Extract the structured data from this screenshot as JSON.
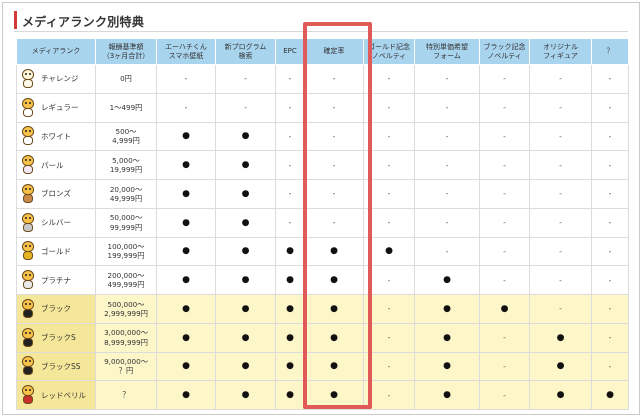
{
  "title": "メディアランク別特典",
  "headers": [
    "メディアランク",
    "報酬基準額\n（3ヶ月合計）",
    "エーハチくん\nスマホ壁紙",
    "新プログラム\n検索",
    "EPC",
    "確定率",
    "ゴールド記念\nノベルティ",
    "特別単価希望\nフォーム",
    "ブラック記念\nノベルティ",
    "オリジナル\nフィギュア",
    "？"
  ],
  "rows": [
    {
      "rank": "チャレンジ",
      "price": "0円",
      "premium": false,
      "cells": [
        "-",
        "-",
        "-",
        "-",
        "-",
        "-",
        "-",
        "-",
        "-"
      ],
      "avatar": {
        "head": "#fff6d8",
        "body": "#fffbe8"
      }
    },
    {
      "rank": "レギュラー",
      "price": "1〜499円",
      "premium": false,
      "cells": [
        "-",
        "-",
        "-",
        "-",
        "-",
        "-",
        "-",
        "-",
        "-"
      ],
      "avatar": {
        "head": "#f6c24a",
        "body": "#ffffff"
      }
    },
    {
      "rank": "ホワイト",
      "price": "500〜\n4,999円",
      "premium": false,
      "cells": [
        "●",
        "●",
        "-",
        "-",
        "-",
        "-",
        "-",
        "-",
        "-"
      ],
      "avatar": {
        "head": "#f6c24a",
        "body": "#ffffff"
      }
    },
    {
      "rank": "パール",
      "price": "5,000〜\n19,999円",
      "premium": false,
      "cells": [
        "●",
        "●",
        "-",
        "-",
        "-",
        "-",
        "-",
        "-",
        "-"
      ],
      "avatar": {
        "head": "#f6c24a",
        "body": "#f3e7f7"
      }
    },
    {
      "rank": "ブロンズ",
      "price": "20,000〜\n49,999円",
      "premium": false,
      "cells": [
        "●",
        "●",
        "-",
        "-",
        "-",
        "-",
        "-",
        "-",
        "-"
      ],
      "avatar": {
        "head": "#f6c24a",
        "body": "#c98a4a"
      }
    },
    {
      "rank": "シルバー",
      "price": "50,000〜\n99,999円",
      "premium": false,
      "cells": [
        "●",
        "●",
        "-",
        "-",
        "-",
        "-",
        "-",
        "-",
        "-"
      ],
      "avatar": {
        "head": "#f6c24a",
        "body": "#c8c8c8"
      }
    },
    {
      "rank": "ゴールド",
      "price": "100,000〜\n199,999円",
      "premium": false,
      "cells": [
        "●",
        "●",
        "●",
        "●",
        "●",
        "-",
        "-",
        "-",
        "-"
      ],
      "avatar": {
        "head": "#f6c24a",
        "body": "#e5b521"
      }
    },
    {
      "rank": "プラチナ",
      "price": "200,000〜\n499,999円",
      "premium": false,
      "cells": [
        "●",
        "●",
        "●",
        "●",
        "-",
        "●",
        "-",
        "-",
        "-"
      ],
      "avatar": {
        "head": "#f6c24a",
        "body": "#e8e8e8"
      }
    },
    {
      "rank": "ブラック",
      "price": "500,000〜\n2,999,999円",
      "premium": true,
      "cells": [
        "●",
        "●",
        "●",
        "●",
        "-",
        "●",
        "●",
        "-",
        "-"
      ],
      "avatar": {
        "head": "#f6c24a",
        "body": "#222222"
      }
    },
    {
      "rank": "ブラックS",
      "price": "3,000,000〜\n8,999,999円",
      "premium": true,
      "cells": [
        "●",
        "●",
        "●",
        "●",
        "-",
        "●",
        "-",
        "●",
        "-"
      ],
      "avatar": {
        "head": "#f6c24a",
        "body": "#222222"
      }
    },
    {
      "rank": "ブラックSS",
      "price": "9,000,000〜\n？円",
      "premium": true,
      "cells": [
        "●",
        "●",
        "●",
        "●",
        "-",
        "●",
        "-",
        "●",
        "-"
      ],
      "avatar": {
        "head": "#f6c24a",
        "body": "#222222"
      }
    },
    {
      "rank": "レッドベリル",
      "price": "？",
      "premium": true,
      "cells": [
        "●",
        "●",
        "●",
        "●",
        "-",
        "●",
        "-",
        "●",
        "●"
      ],
      "avatar": {
        "head": "#f6c24a",
        "body": "#c9302c"
      }
    }
  ],
  "colors": {
    "header_bg": "#a9d4ee",
    "premium_bg": "#fdf6c9",
    "highlight_border": "#e05a5a",
    "title_accent": "#d23a3a"
  },
  "highlight_column": "確定率"
}
